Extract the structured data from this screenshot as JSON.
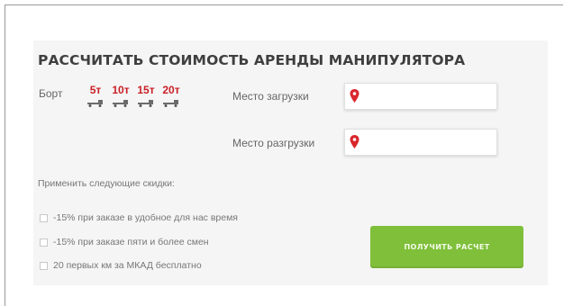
{
  "form": {
    "title": "РАССЧИТАТЬ СТОИМОСТЬ АРЕНДЫ МАНИПУЛЯТОРА",
    "board_label": "Борт",
    "weights": [
      "5т",
      "10т",
      "15т",
      "20т"
    ],
    "loading_label": "Место загрузки",
    "loading_value": "",
    "unloading_label": "Место разгрузки",
    "unloading_value": "",
    "discounts_heading": "Применить следующие скидки:",
    "discounts": [
      "-15% при заказе в удобное для нас время",
      "-15% при заказе пяти и более смен",
      "20 первых км за МКАД бесплатно"
    ],
    "submit_label": "ПОЛУЧИТЬ РАСЧЕТ"
  },
  "colors": {
    "accent_red": "#c91f26",
    "button_green": "#7fbf3a",
    "card_bg": "#f5f5f5"
  },
  "icons": {
    "location": "map-pin-icon",
    "truck": "truck-icon"
  }
}
